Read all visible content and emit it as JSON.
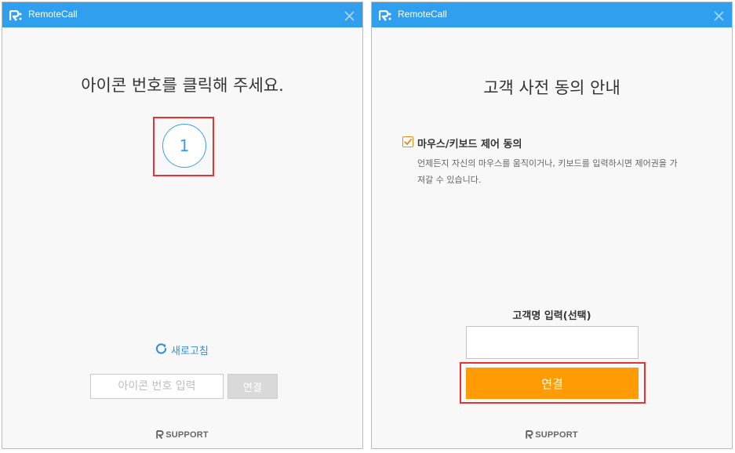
{
  "windows": [
    {
      "title": "RemoteCall",
      "heading": "아이콘 번호를 클릭해 주세요.",
      "icon_number": "1",
      "refresh_label": "새로고침",
      "code_input_placeholder": "아이콘 번호 입력",
      "connect_label": "연결",
      "brand": "SUPPORT"
    },
    {
      "title": "RemoteCall",
      "heading": "고객 사전 동의 안내",
      "consent": {
        "label": "마우스/키보드 제어 동의",
        "checked": true,
        "description": "언제든지 자신의 마우스를 움직이거나, 키보드를 입력하시면 제어권을 가져갈 수 있습니다."
      },
      "customer_name_label": "고객명 입력(선택)",
      "customer_name_value": "",
      "connect_label": "연결",
      "brand": "SUPPORT"
    }
  ],
  "colors": {
    "titlebar": "#2f9fee",
    "accent_orange": "#ff9c05",
    "highlight_red": "#e63135",
    "link_blue": "#2f8fd9"
  },
  "icons": [
    "remotecall-logo-icon",
    "close-icon",
    "refresh-icon",
    "check-icon",
    "rsupport-logo-icon"
  ]
}
